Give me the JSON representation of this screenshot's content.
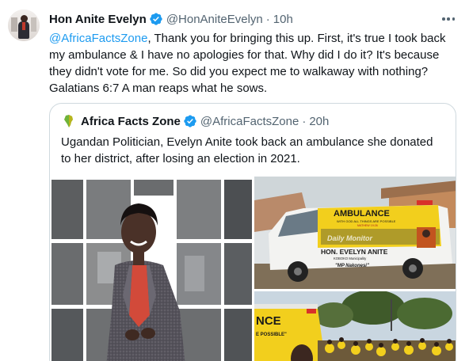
{
  "tweet": {
    "author_name": "Hon Anite Evelyn",
    "author_handle": "@HonAniteEvelyn",
    "separator": "·",
    "time": "10h",
    "reply_to": "@AfricaFactsZone",
    "body": ", Thank you for bringing this up. First, it's true I took back my ambulance & I have no apologies for that. Why did I do it? It's because they didn't vote for me. So did you expect me to walkaway with nothing? Galatians 6:7 A man reaps what he sows."
  },
  "quoted_tweet": {
    "author_name": "Africa Facts Zone",
    "author_handle": "@AfricaFactsZone",
    "separator": "·",
    "time": "20h",
    "body": "Ugandan Politician, Evelyn Anite took back an ambulance she donated to her district, after losing an election in 2021.",
    "media": {
      "ambulance_label": "AMBULANCE",
      "ambulance_slogan": "WITH GOD ALL THINGS ARE POSSIBLE",
      "ambulance_verse": "MATHEW 19:26",
      "watermark": "Daily Monitor",
      "donor_name": "HON. EVELYN ANITE",
      "donor_place": "KOBOKO Municipality",
      "donor_nickname": "\"MP Nakonesi\"",
      "crowd_ambulance_partial": "NCE",
      "crowd_ambulance_slogan_partial": "E POSSIBLE\""
    }
  },
  "colors": {
    "link": "#1d9bf0",
    "verified": "#1d9bf0",
    "secondary_text": "#536471",
    "border": "#cfd9de",
    "ambulance_yellow": "#f2cf1d"
  }
}
